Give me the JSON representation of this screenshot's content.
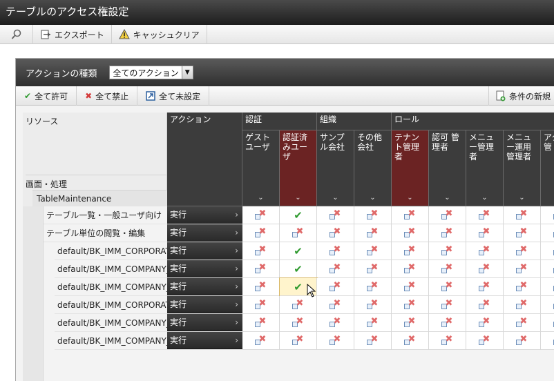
{
  "window": {
    "title": "テーブルのアクセス権設定"
  },
  "toolbar": {
    "search_icon": "magnifier-icon",
    "export_label": "エクスポート",
    "cache_clear_label": "キャッシュクリア"
  },
  "panel": {
    "action_type_label": "アクションの種類",
    "action_type_value": "全てのアクション",
    "allow_all_label": "全て許可",
    "deny_all_label": "全て禁止",
    "unset_all_label": "全て未設定",
    "new_condition_label": "条件の新規"
  },
  "grid": {
    "resource_header": "リソース",
    "screen_header": "画面・処理",
    "table_maintenance": "TableMaintenance",
    "action_header": "アクション",
    "group_auth": "認証",
    "group_org": "組織",
    "group_role": "ロール",
    "columns": [
      "ゲストユーザ",
      "認証済みユーザ",
      "サンプル会社",
      "その他会社",
      "テナント管理者",
      "認可 管理者",
      "メニュー管理者",
      "メニュー運用管理者",
      "アクト管"
    ],
    "rows": [
      {
        "label": "テーブル一覧・一般ユーザ向け",
        "action": "実行",
        "perms": [
          "x",
          "ok",
          "x",
          "x",
          "x",
          "x",
          "x",
          "x",
          "x"
        ]
      },
      {
        "label": "テーブル単位の閲覧・編集",
        "action": "実行",
        "perms": [
          "x",
          "x",
          "x",
          "x",
          "x",
          "x",
          "x",
          "x",
          "x"
        ]
      },
      {
        "label": "default/BK_IMM_CORPORATION",
        "action": "実行",
        "perms": [
          "x",
          "ok",
          "x",
          "x",
          "x",
          "x",
          "x",
          "x",
          "x"
        ]
      },
      {
        "label": "default/BK_IMM_COMPANY_ORP",
        "action": "実行",
        "perms": [
          "x",
          "ok",
          "x",
          "x",
          "x",
          "x",
          "x",
          "x",
          "x"
        ]
      },
      {
        "label": "default/BK_IMM_COMPANY_ORP_ATH",
        "action": "実行",
        "perms": [
          "x",
          "ok",
          "x",
          "x",
          "x",
          "x",
          "x",
          "x",
          "x"
        ]
      },
      {
        "label": "default/BK_IMM_CORPORATION_ATH",
        "action": "実行",
        "perms": [
          "x",
          "x",
          "x",
          "x",
          "x",
          "x",
          "x",
          "x",
          "x"
        ]
      },
      {
        "label": "default/BK_IMM_COMPANY_ORP_INC_ATH",
        "action": "実行",
        "perms": [
          "x",
          "x",
          "x",
          "x",
          "x",
          "x",
          "x",
          "x",
          "x"
        ]
      },
      {
        "label": "default/BK_IMM_COMPANY_POST",
        "action": "実行",
        "perms": [
          "x",
          "x",
          "x",
          "x",
          "x",
          "x",
          "x",
          "x",
          "x"
        ]
      }
    ]
  }
}
